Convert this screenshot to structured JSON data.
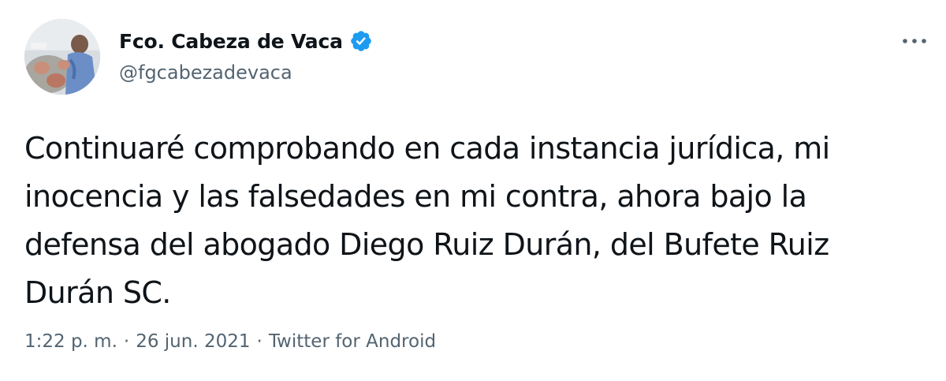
{
  "author": {
    "display_name": "Fco. Cabeza de Vaca",
    "handle": "@fgcabezadevaca",
    "verified": true,
    "avatar": "profile-photo"
  },
  "tweet": {
    "text": "Continuaré comprobando en cada instancia jurídica, mi\ninocencia y las falsedades en mi contra, ahora bajo la\ndefensa del abogado Diego Ruiz Durán, del Bufete Ruiz\nDurán SC."
  },
  "meta": {
    "time": "1:22 p. m.",
    "separator": "·",
    "date": "26 jun. 2021",
    "source": "Twitter for Android"
  },
  "icons": {
    "verified": "verified-badge-icon",
    "more": "more-options-icon"
  },
  "colors": {
    "text_primary": "#0f1419",
    "text_secondary": "#536471",
    "verified_blue": "#1d9bf0",
    "background": "#ffffff"
  }
}
